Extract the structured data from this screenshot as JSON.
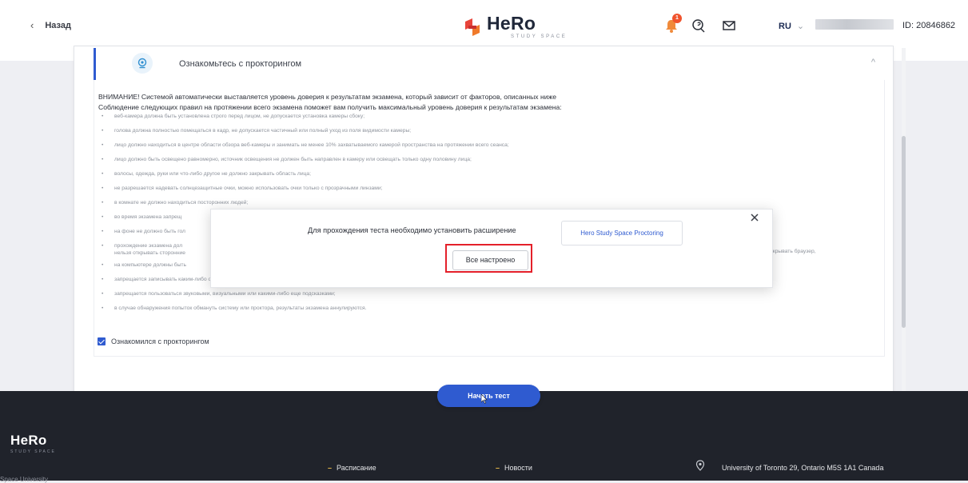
{
  "header": {
    "back_label": "Назад",
    "logo_text": "HeRo",
    "logo_subtext": "STUDY SPACE",
    "notification_count": "1",
    "language": "RU",
    "language_dropdown": "⌄",
    "user_id": "ID: 20846862"
  },
  "accordion": {
    "title": "Ознакомьтесь с прокторингом",
    "toggle": "^",
    "warning_line1": "ВНИМАНИЕ! Системой автоматически выставляется уровень доверия к результатам экзамена, который зависит от факторов, описанных ниже",
    "warning_line2": "Соблюдение следующих правил на протяжении всего экзамена поможет вам получить максимальный уровень доверия к результатам экзамена:",
    "rules": [
      "веб-камера должна быть установлена строго перед лицом, не допускается установка камеры сбоку;",
      "голова должна полностью помещаться в кадр, не допускается частичный или полный уход из поля видимости камеры;",
      "лицо должно находиться в центре области обзора веб-камеры и занимать не менее 10% захватываемого камерой пространства на протяжении всего сеанса;",
      "лицо должно быть освещено равномерно, источник освещения не должен быть направлен в камеру или освещать только одну половину лица;",
      "волосы, одежда, руки или что-либо другое не должно закрывать область лица;",
      "не разрешается надевать солнцезащитные очки, можно использовать очки только с прозрачными линзами;",
      "в комнате не должно находиться посторонних людей;",
      "во время экзамена запрещ",
      "на фоне не должно быть гол",
      "прохождение экзамена дол",
      "на компьютере должны быть",
      "запрещается записывать каким-либо образом материалы и содержимое экзамена, а также передавать их третьим лицам;",
      "запрещается пользоваться звуковыми, визуальными или какими-либо еще подсказками;",
      "в случае обнаружения попыток обмануть систему или проктора, результаты экзамена аннулируются."
    ],
    "rule_continuation_left": "нельзя открывать сторонние",
    "rule_continuation_right": "закрывать браузер,",
    "agree_label": "Ознакомился с прокторингом"
  },
  "modal": {
    "message": "Для прохождения теста необходимо установить расширение",
    "extension_button": "Hero Study Space Proctoring",
    "done_button": "Все настроено"
  },
  "start_button": "Начать тест",
  "footer": {
    "logo_text": "HeRo",
    "logo_subtext": "STUDY SPACE",
    "link_schedule": "Расписание",
    "link_news": "Новости",
    "address": "University of Toronto 29, Ontario M5S 1A1 Canada",
    "bottom_text": "Space University"
  },
  "colors": {
    "accent": "#2f5bd0",
    "highlight": "#e4202a",
    "footer_bg": "#20232b",
    "badge": "#f0532d"
  }
}
